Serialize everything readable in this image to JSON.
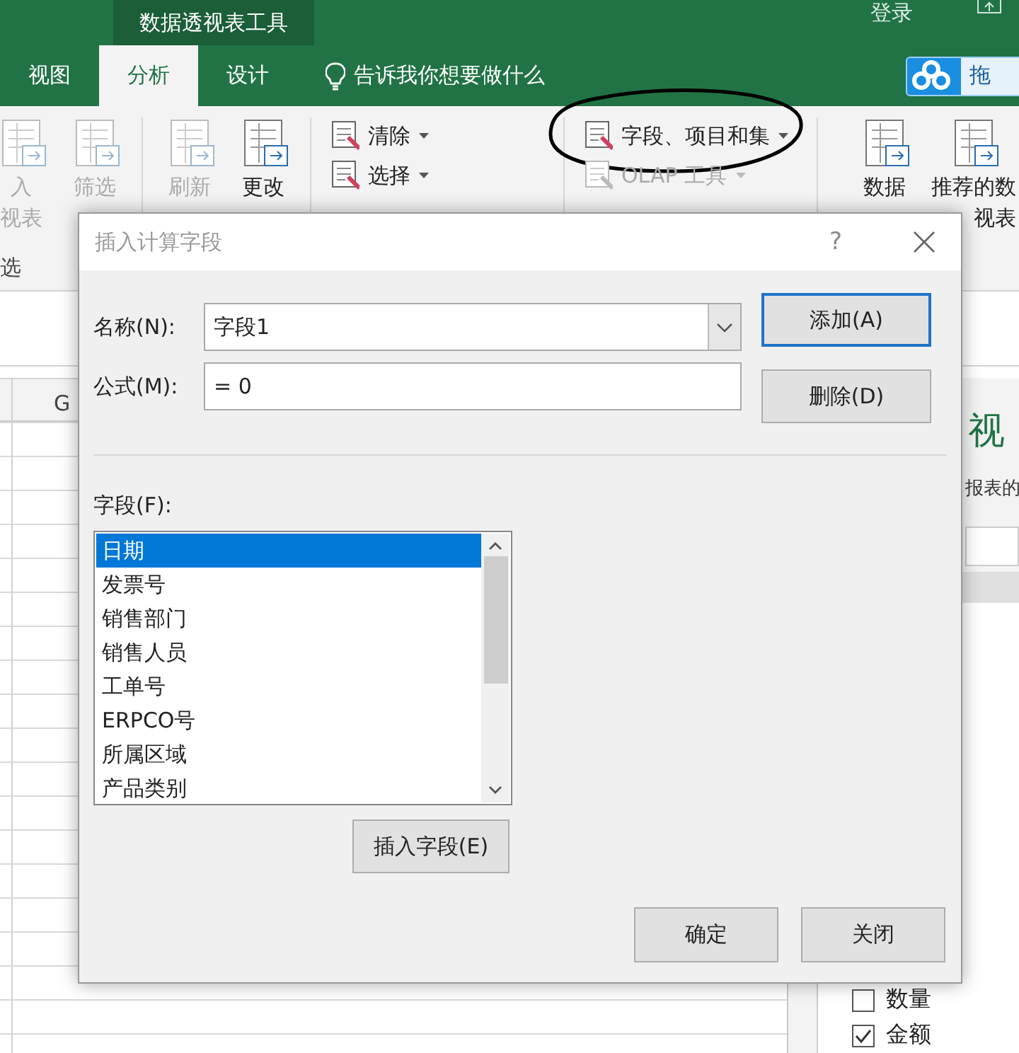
{
  "contextual_tab_group": "数据透视表工具",
  "sign_in": "登录",
  "cloud_button": {
    "label": "拖"
  },
  "tabs": [
    {
      "label": "视图",
      "selected": false
    },
    {
      "label": "分析",
      "selected": true
    },
    {
      "label": "设计",
      "selected": false
    }
  ],
  "tell_me": "告诉我你想要做什么",
  "ribbon": {
    "groups": [
      {
        "items": [
          {
            "kind": "large",
            "lines": [
              "入",
              "视表"
            ],
            "disabled": true,
            "circled": false
          },
          {
            "kind": "large",
            "lines": [
              "筛选"
            ],
            "disabled": true,
            "circled": false
          }
        ]
      },
      {
        "items": [
          {
            "kind": "large",
            "lines": [
              "刷新"
            ],
            "disabled": true,
            "circled": false
          },
          {
            "kind": "large",
            "lines": [
              "更改"
            ],
            "disabled": false,
            "circled": false
          }
        ]
      },
      {
        "items": [
          {
            "kind": "small",
            "lines": [
              "清除"
            ],
            "disabled": false,
            "circled": false
          },
          {
            "kind": "small",
            "lines": [
              "选择"
            ],
            "disabled": false,
            "circled": false
          }
        ]
      },
      {
        "items": [
          {
            "kind": "small",
            "lines": [
              "字段、项目和集"
            ],
            "disabled": false,
            "circled": true
          },
          {
            "kind": "small",
            "lines": [
              "OLAP 工具"
            ],
            "disabled": true,
            "circled": false
          }
        ]
      },
      {
        "items": [
          {
            "kind": "large",
            "lines": [
              "数据"
            ],
            "disabled": false,
            "circled": false
          },
          {
            "kind": "large",
            "lines": [
              "推荐的数",
              "视表"
            ],
            "disabled": false,
            "circled": false
          }
        ]
      }
    ],
    "group_label": "选"
  },
  "sheet": {
    "column_header": "G"
  },
  "task_pane": {
    "heading": "视",
    "description": "报表的",
    "fields": [
      {
        "label": "数量",
        "checked": false
      },
      {
        "label": "金额",
        "checked": true
      }
    ]
  },
  "dialog": {
    "title": "插入计算字段",
    "help": "?",
    "name_label": "名称(N):",
    "name_value": "字段1",
    "formula_label": "公式(M):",
    "formula_value": "= 0",
    "add_button": "添加(A)",
    "delete_button": "删除(D)",
    "fields_label": "字段(F):",
    "fields": [
      {
        "label": "日期",
        "selected": true
      },
      {
        "label": "发票号",
        "selected": false
      },
      {
        "label": "销售部门",
        "selected": false
      },
      {
        "label": "销售人员",
        "selected": false
      },
      {
        "label": "工单号",
        "selected": false
      },
      {
        "label": "ERPCO号",
        "selected": false
      },
      {
        "label": "所属区域",
        "selected": false
      },
      {
        "label": "产品类别",
        "selected": false
      }
    ],
    "insert_field_button": "插入字段(E)",
    "ok_button": "确定",
    "close_button": "关闭"
  }
}
